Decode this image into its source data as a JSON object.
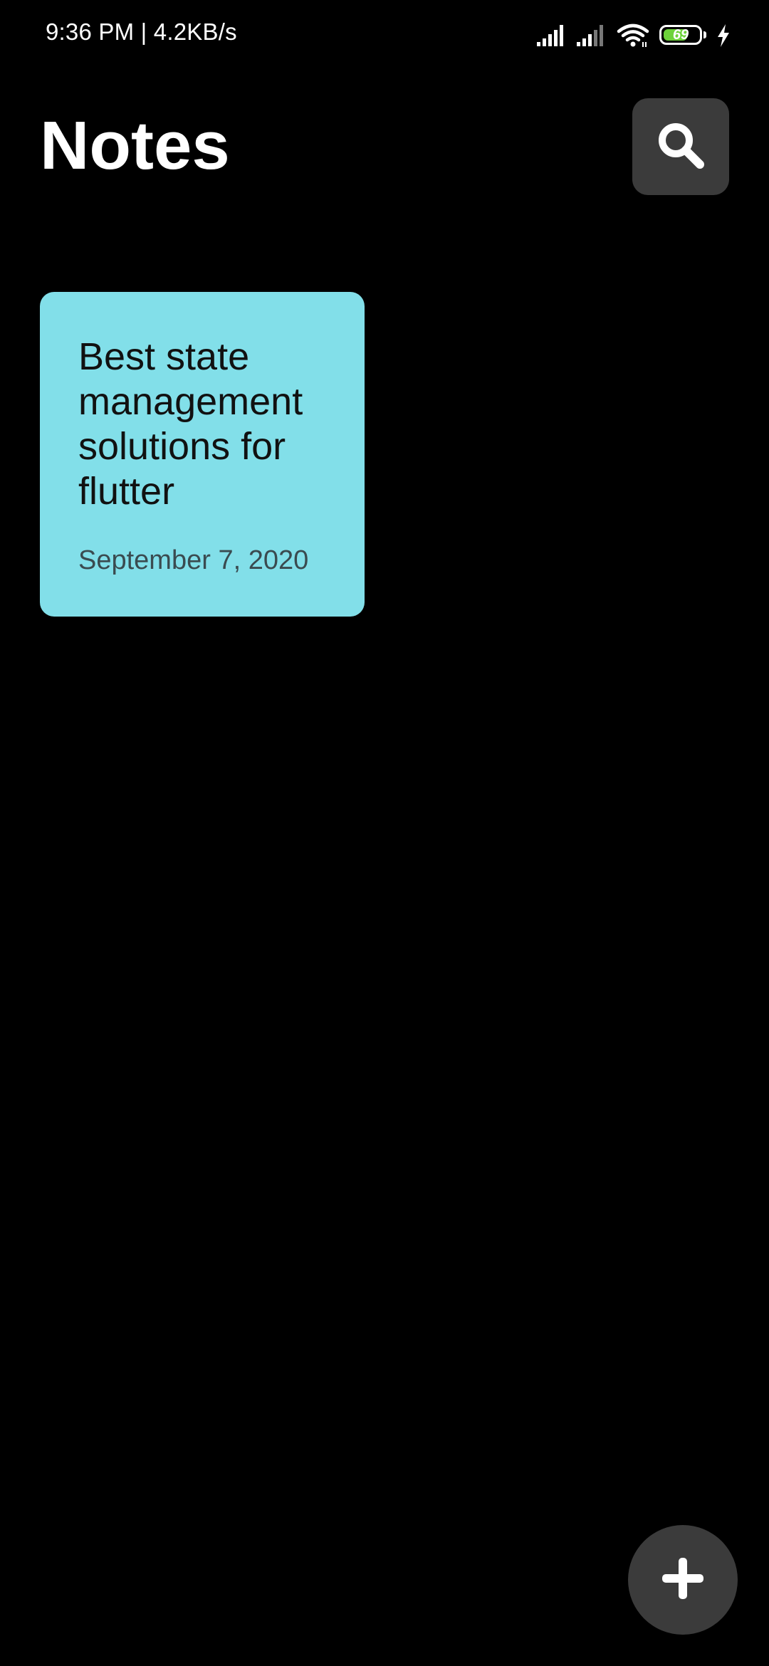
{
  "status_bar": {
    "time_speed": "9:36 PM | 4.2KB/s",
    "battery_level": "69",
    "battery_fill_fraction": 0.69,
    "icons": [
      "signal-icon",
      "signal-icon",
      "wifi-icon",
      "battery-icon",
      "charging-icon"
    ]
  },
  "header": {
    "title": "Notes",
    "search_icon": "search-icon"
  },
  "notes": [
    {
      "title": "Best state management solutions for flutter",
      "date": "September 7, 2020",
      "color": "#82dfe9"
    }
  ],
  "fab": {
    "icon": "plus-icon"
  },
  "colors": {
    "background": "#000000",
    "button_bg": "#3b3b3b",
    "battery_green": "#6dd23a"
  }
}
